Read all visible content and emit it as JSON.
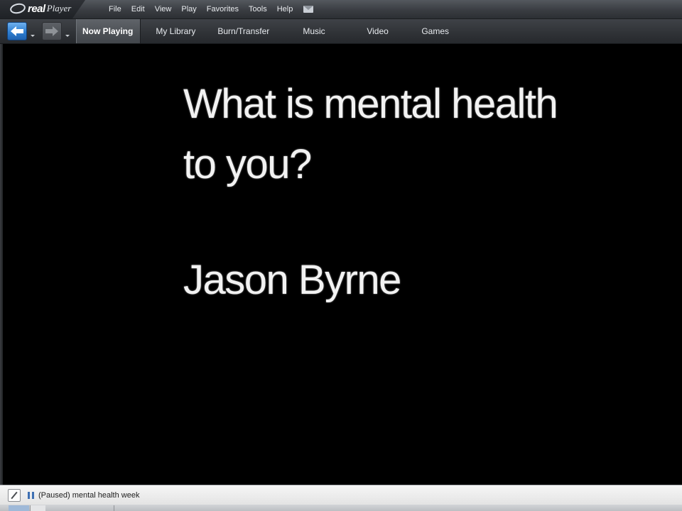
{
  "app": {
    "logo_text_real": "real",
    "logo_text_player": "Player"
  },
  "menu": {
    "items": [
      {
        "label": "File"
      },
      {
        "label": "Edit"
      },
      {
        "label": "View"
      },
      {
        "label": "Play"
      },
      {
        "label": "Favorites"
      },
      {
        "label": "Tools"
      },
      {
        "label": "Help"
      }
    ],
    "mail_icon": "mail-icon"
  },
  "nav": {
    "back_icon": "arrow-left-icon",
    "forward_icon": "arrow-right-icon",
    "tabs": [
      {
        "label": "Now Playing",
        "active": true
      },
      {
        "label": "My Library",
        "active": false
      },
      {
        "label": "Burn/Transfer",
        "active": false
      },
      {
        "label": "Music",
        "active": false
      },
      {
        "label": "Video",
        "active": false
      },
      {
        "label": "Games",
        "active": false
      }
    ]
  },
  "video": {
    "caption_line1": "What is mental health",
    "caption_line2": "to you?",
    "caption_line3": "Jason Byrne"
  },
  "status": {
    "text": "(Paused) mental health week",
    "state_icon": "pause-icon"
  },
  "colors": {
    "accent_blue": "#2f7fd1",
    "video_background": "#000000",
    "toolbar_dark": "#2f3236"
  }
}
